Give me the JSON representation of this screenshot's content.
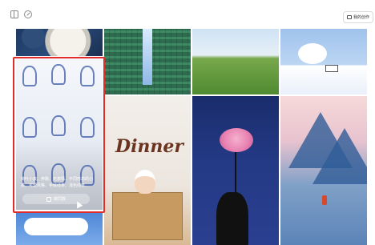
{
  "header": {
    "my_works_label": "我的创作"
  },
  "gallery": {
    "hovered_card": {
      "caption": "荷叶小孩、奔跑、无表情、不同形态的小孩、可爱风格、手绘线条、浅色线条、",
      "action_label": "做同款"
    },
    "tiles": [
      {
        "name": "peony-tile"
      },
      {
        "name": "running-kids-tile"
      },
      {
        "name": "circuit-waterfall-tile"
      },
      {
        "name": "dinner-chef-tile"
      },
      {
        "name": "grass-field-tile"
      },
      {
        "name": "flower-hand-night-tile"
      },
      {
        "name": "winter-house-tile"
      },
      {
        "name": "mountain-temple-tile"
      },
      {
        "name": "clouds-tile"
      }
    ],
    "dinner_title": "Dinner"
  },
  "colors": {
    "highlight": "#e22b2b",
    "primary_text": "#333333",
    "background": "#ffffff"
  }
}
